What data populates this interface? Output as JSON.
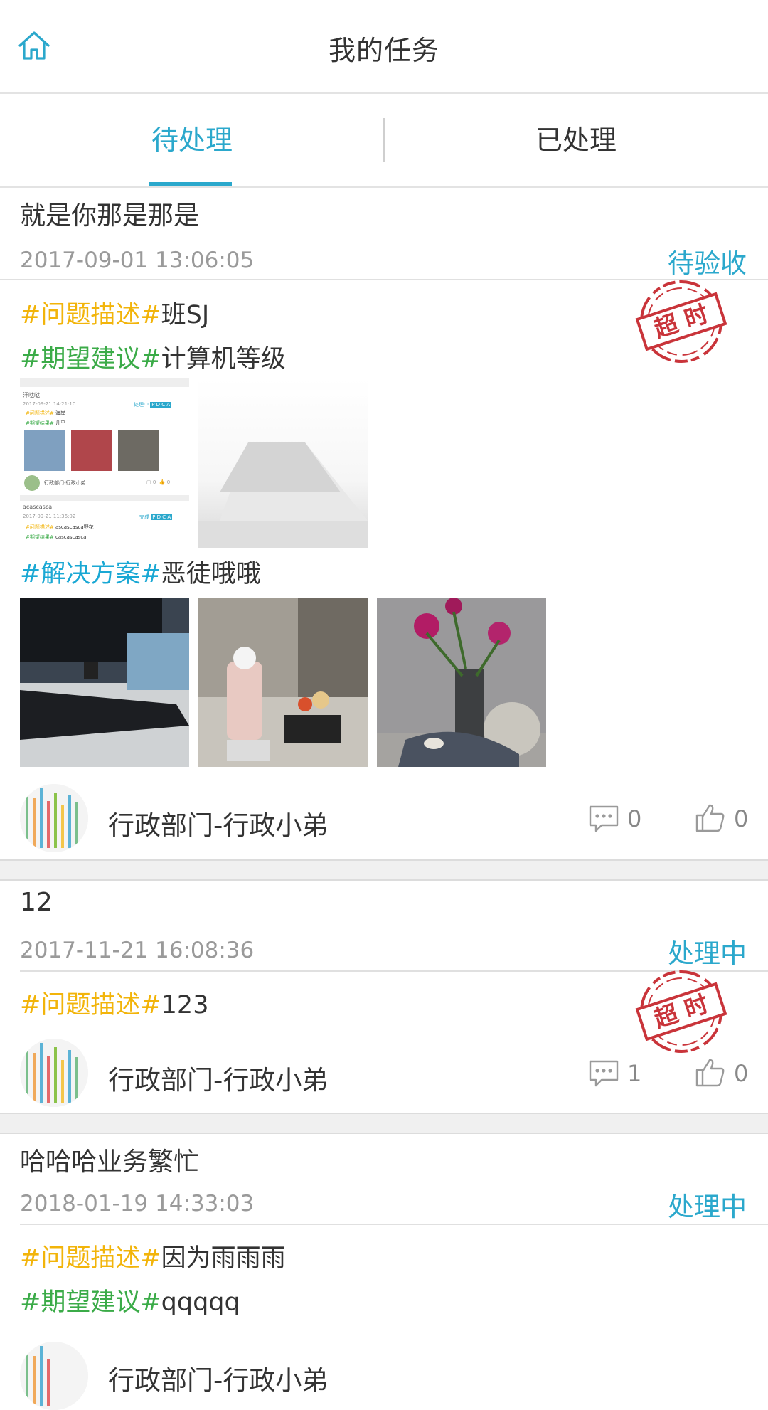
{
  "header": {
    "title": "我的任务",
    "home_icon": "home-icon"
  },
  "tabs": [
    {
      "label": "待处理",
      "active": true
    },
    {
      "label": "已处理",
      "active": false
    }
  ],
  "colors": {
    "accent": "#2ba8cc",
    "problem_tag": "#f2b40a",
    "expect_tag": "#3bab48",
    "solution_tag": "#1aa8d4",
    "stamp": "#c9343a"
  },
  "tasks": [
    {
      "title": "就是你那是那是",
      "date": "2017-09-01 13:06:05",
      "status": "待验收",
      "stamp": "超 时",
      "problem_tag": "#问题描述#",
      "problem_text": "班SJ",
      "expect_tag": "#期望建议#",
      "expect_text": "计算机等级",
      "solution_tag": "#解决方案#",
      "solution_text": "恶徒哦哦",
      "attachment_thumbs": [
        {
          "name": "screenshot-thumb",
          "rows": [
            {
              "name": "汗哒哒",
              "date": "2017-09-21 14:21:10",
              "status": "处理中",
              "pdca": "P D C A",
              "problem_tag": "#问题描述#",
              "problem_text": "海岸",
              "result_tag": "#期望结果#",
              "result_text": "几乎",
              "author": "行政部门-行政小弟",
              "comments": "0",
              "likes": "0"
            },
            {
              "name": "acascasca",
              "date": "2017-09-21 11:36:02",
              "status": "完成",
              "pdca": "P D C A",
              "problem_tag": "#问题描述#",
              "problem_text": "ascascasca野花",
              "result_tag": "#期望结果#",
              "result_text": "cascascasca"
            }
          ]
        },
        {
          "name": "blank-photo-thumb"
        }
      ],
      "solution_thumbs": [
        "monitor-photo",
        "desk-photo",
        "flower-vase-photo"
      ],
      "author": "行政部门-行政小弟",
      "comments": "0",
      "likes": "0"
    },
    {
      "title": "12",
      "date": "2017-11-21 16:08:36",
      "status": "处理中",
      "stamp": "超 时",
      "problem_tag": "#问题描述#",
      "problem_text": "123",
      "author": "行政部门-行政小弟",
      "comments": "1",
      "likes": "0"
    },
    {
      "title": "哈哈哈业务繁忙",
      "date": "2018-01-19 14:33:03",
      "status": "处理中",
      "problem_tag": "#问题描述#",
      "problem_text": "因为雨雨雨",
      "expect_tag": "#期望建议#",
      "expect_text": "qqqqq",
      "author": "行政部门-行政小弟"
    }
  ]
}
